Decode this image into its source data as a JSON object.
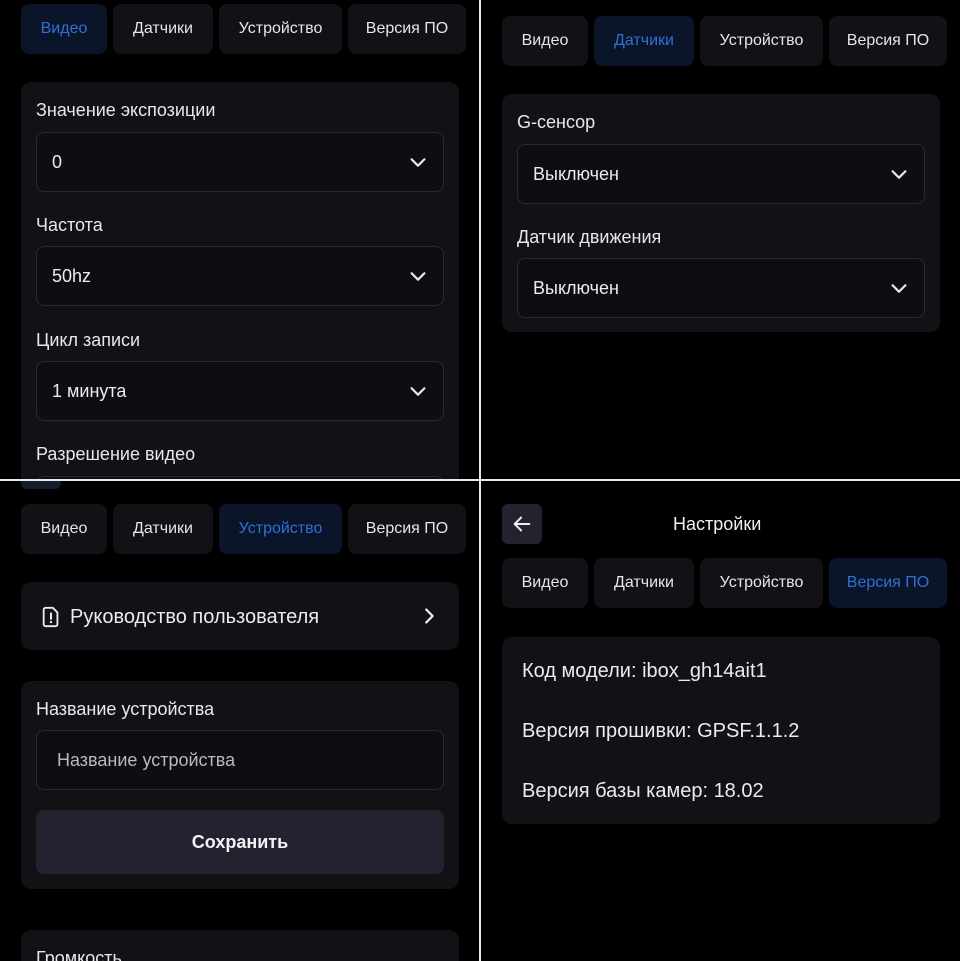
{
  "tabs": {
    "video": "Видео",
    "sensors": "Датчики",
    "device": "Устройство",
    "firmware": "Версия ПО"
  },
  "video": {
    "exposure": {
      "label": "Значение экспозиции",
      "value": "0"
    },
    "frequency": {
      "label": "Частота",
      "value": "50hz"
    },
    "loop": {
      "label": "Цикл записи",
      "value": "1 минута"
    },
    "resolution": {
      "label": "Разрешение видео"
    }
  },
  "sensors": {
    "gsensor": {
      "label": "G-сенсор",
      "value": "Выключен"
    },
    "motion": {
      "label": "Датчик движения",
      "value": "Выключен"
    }
  },
  "device": {
    "manual": "Руководство пользователя",
    "name_label": "Название устройства",
    "name_placeholder": "Название устройства",
    "save": "Сохранить",
    "volume_label": "Громкость"
  },
  "settings": {
    "title": "Настройки",
    "model": "Код модели: ibox_gh14ait1",
    "firmware": "Версия прошивки: GPSF.1.1.2",
    "camera_db": "Версия базы камер: 18.02"
  },
  "colors": {
    "background": "#000000",
    "card": "#121216",
    "active_tab_text": "#2f6fd6",
    "active_tab_bg": "#0b1529"
  },
  "icons": {
    "select": "chevron-down-icon",
    "link": "chevron-right-icon",
    "manual": "document-info-icon",
    "back": "arrow-left-icon"
  }
}
